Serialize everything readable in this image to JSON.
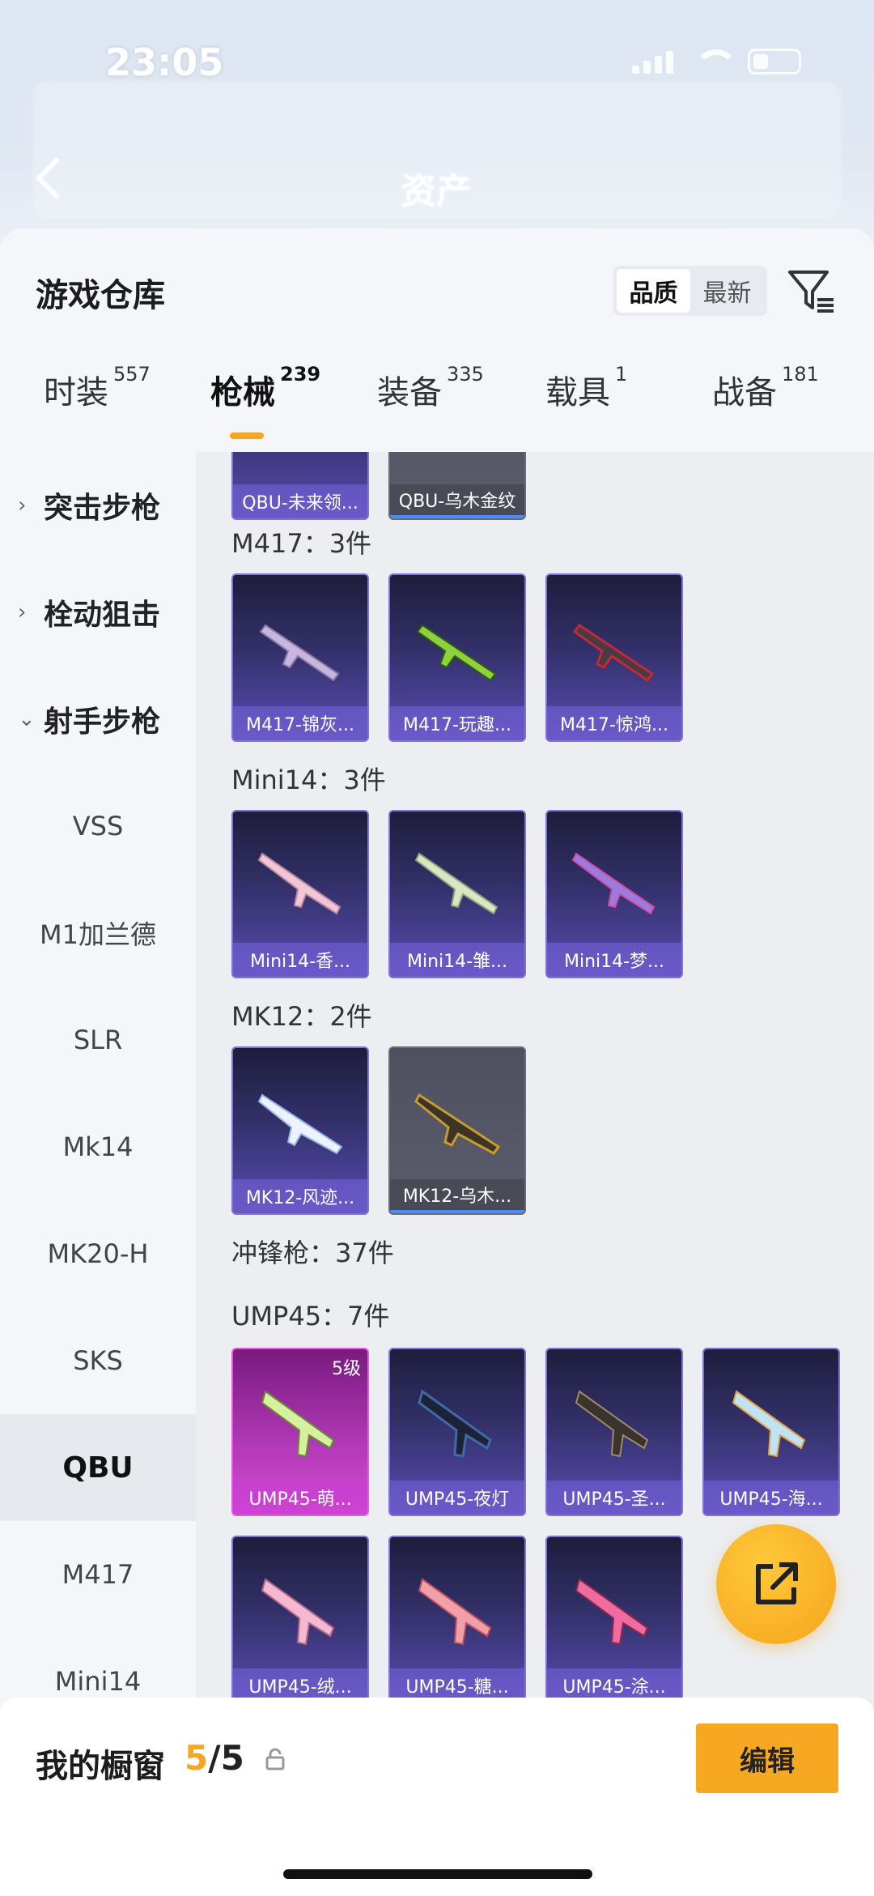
{
  "status": {
    "time": "23:05"
  },
  "header": {
    "title": "资产"
  },
  "sheet": {
    "title": "游戏仓库",
    "sort": {
      "options": [
        "品质",
        "最新"
      ],
      "selected": "品质"
    }
  },
  "tabs": [
    {
      "label": "时装",
      "count": "557"
    },
    {
      "label": "枪械",
      "count": "239"
    },
    {
      "label": "装备",
      "count": "335"
    },
    {
      "label": "载具",
      "count": "1"
    },
    {
      "label": "战备",
      "count": "181"
    }
  ],
  "sidebar": {
    "categories": [
      "突击步枪",
      "栓动狙击",
      "射手步枪"
    ],
    "subitems": [
      "VSS",
      "M1加兰德",
      "SLR",
      "Mk14",
      "MK20-H",
      "SKS",
      "QBU",
      "M417",
      "Mini14"
    ],
    "active": "QBU"
  },
  "content": {
    "top_cards": [
      "QBU-未来领...",
      "QBU-乌木金纹"
    ],
    "groups": [
      {
        "label": "M417：3件",
        "cards": [
          "M417-锦灰...",
          "M417-玩趣...",
          "M417-惊鸿..."
        ]
      },
      {
        "label": "Mini14：3件",
        "cards": [
          "Mini14-香...",
          "Mini14-雏...",
          "Mini14-梦..."
        ]
      },
      {
        "label": "MK12：2件",
        "cards": [
          "MK12-风迹...",
          "MK12-乌木..."
        ]
      }
    ],
    "smg_label": "冲锋枪：37件",
    "ump_label": "UMP45：7件",
    "ump_cards": [
      "UMP45-萌...",
      "UMP45-夜灯",
      "UMP45-圣...",
      "UMP45-海...",
      "UMP45-绒...",
      "UMP45-糖...",
      "UMP45-涂..."
    ],
    "ump_level": "5级"
  },
  "bottom": {
    "label": "我的橱窗",
    "count_current": "5",
    "count_total": "/5",
    "edit": "编辑"
  },
  "colors": {
    "accent": "#f5a623",
    "card_purple": "#5a4cb2",
    "card_pink": "#d44ed4"
  }
}
